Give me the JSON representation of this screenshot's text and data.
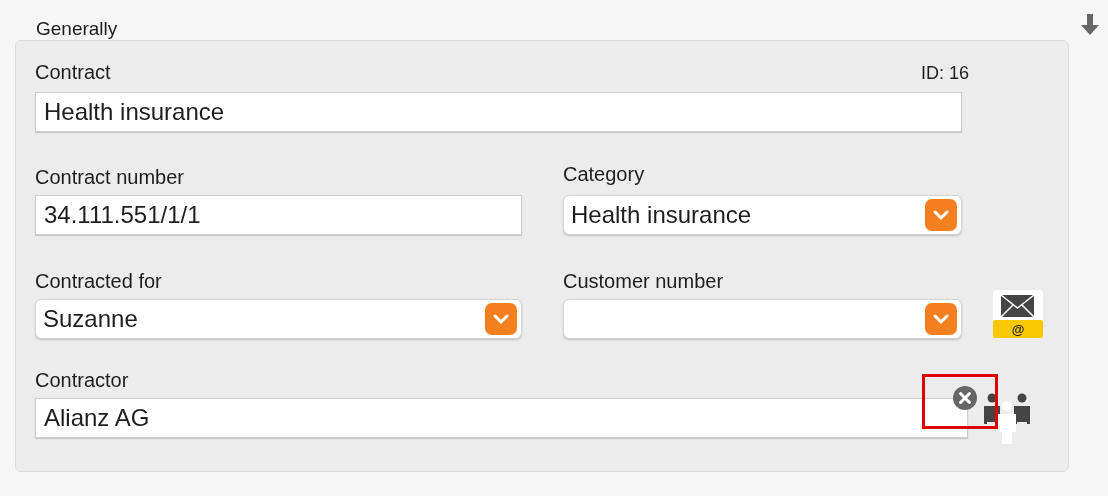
{
  "section_title": "Generally",
  "contract": {
    "label": "Contract",
    "id_text": "ID: 16",
    "value": "Health insurance"
  },
  "fields": [
    {
      "kind": "text",
      "label": "Contract number",
      "value": "34.111.551/1/1"
    },
    {
      "kind": "dropdown",
      "label": "Category",
      "value": "Health insurance"
    },
    {
      "kind": "dropdown",
      "label": "Contracted for",
      "value": "Suzanne"
    },
    {
      "kind": "dropdown",
      "label": "Customer number"
    }
  ],
  "mail_icon": {
    "label": "@"
  },
  "contractor": {
    "label": "Contractor",
    "value": "Alianz AG",
    "highlighted": true
  }
}
